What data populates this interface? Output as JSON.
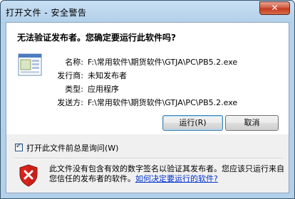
{
  "window": {
    "title": "打开文件 - 安全警告"
  },
  "dialog": {
    "headline": "无法验证发布者。您确定要运行此软件吗?",
    "fields": [
      {
        "label": "名称:",
        "value": "F:\\常用软件\\期货软件\\GTJA\\PC\\PB5.2.exe"
      },
      {
        "label": "发行商:",
        "value": "未知发布者"
      },
      {
        "label": "类型:",
        "value": "应用程序"
      },
      {
        "label": "发送方:",
        "value": "F:\\常用软件\\期货软件\\GTJA\\PC\\PB5.2.exe"
      }
    ],
    "buttons": {
      "run": "运行(R)",
      "cancel": "取消"
    },
    "checkbox": {
      "label": "打开此文件前总是询问(W)",
      "checked": true
    },
    "warning": {
      "text": "此文件没有包含有效的数字签名以验证其发布者。您应该只运行来自您信任的发布者的软件。",
      "link": "如何决定要运行的软件?"
    }
  },
  "colors": {
    "shield_red": "#d9241c",
    "link": "#0033cc",
    "button_border": "#3c7fb1"
  }
}
